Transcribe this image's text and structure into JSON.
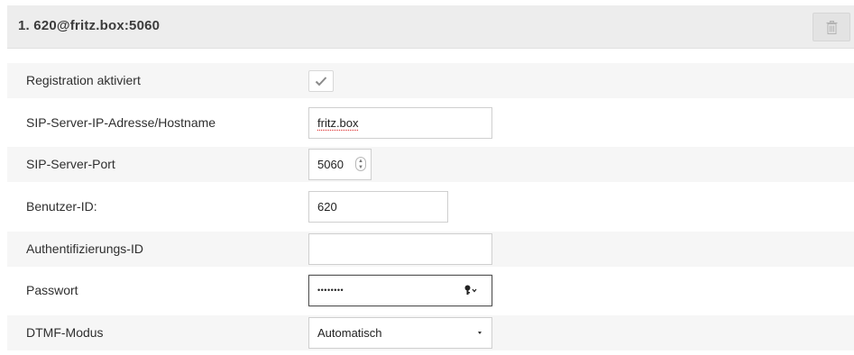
{
  "account": {
    "title": "1. 620@fritz.box:5060",
    "delete_icon": "trash-icon"
  },
  "fields": {
    "registration": {
      "label": "Registration aktiviert",
      "checked": true,
      "icon": "checkmark-icon"
    },
    "server": {
      "label": "SIP-Server-IP-Adresse/Hostname",
      "value": "fritz.box"
    },
    "port": {
      "label": "SIP-Server-Port",
      "value": "5060"
    },
    "user_id": {
      "label": "Benutzer-ID:",
      "value": "620"
    },
    "auth_id": {
      "label": "Authentifizierungs-ID",
      "value": ""
    },
    "password": {
      "label": "Passwort",
      "value": "••••••••",
      "icon": "key-icon"
    },
    "dtmf": {
      "label": "DTMF-Modus",
      "selected": "Automatisch"
    }
  }
}
